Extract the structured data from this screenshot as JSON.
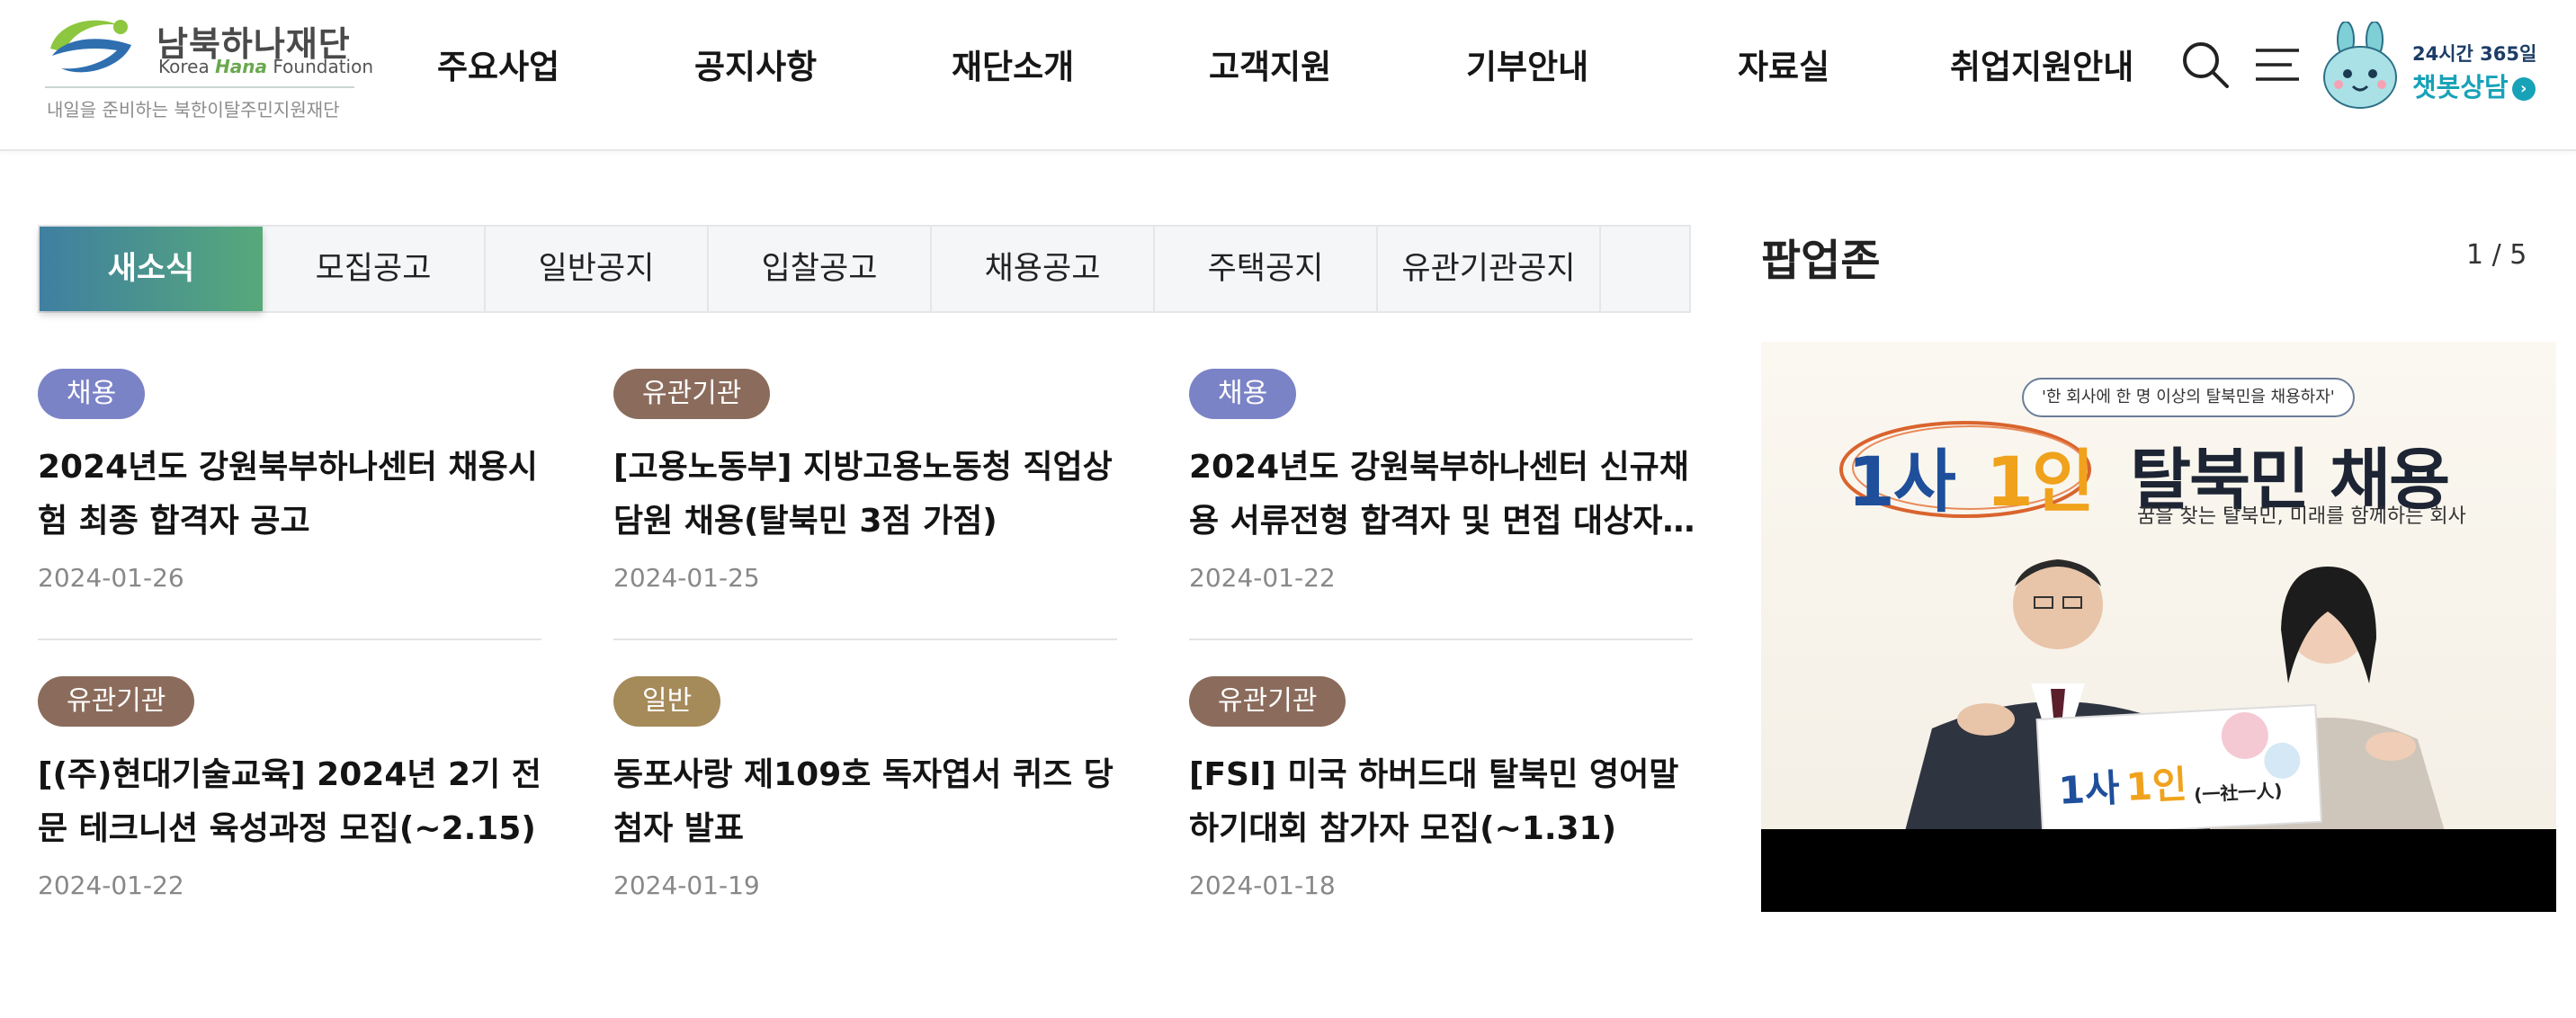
{
  "logo": {
    "korean": "남북하나재단",
    "english_pre": "Korea ",
    "english_hana": "Hana",
    "english_post": " Foundation",
    "tagline": "내일을 준비하는 북한이탈주민지원재단"
  },
  "nav": {
    "items": [
      "주요사업",
      "공지사항",
      "재단소개",
      "고객지원",
      "기부안내",
      "자료실",
      "취업지원안내"
    ]
  },
  "chatbot": {
    "top": "24시간 365일",
    "bottom": "챗봇상담",
    "arrow": "›"
  },
  "tabs": {
    "items": [
      "새소식",
      "모집공고",
      "일반공지",
      "입찰공고",
      "채용공고",
      "주택공지",
      "유관기관공지"
    ],
    "active": "새소식"
  },
  "news": {
    "items": [
      {
        "category": "채용",
        "category_color": "#7b83c7",
        "title": "2024년도 강원북부하나센터 채용시험 최종 합격자 공고",
        "date": "2024-01-26"
      },
      {
        "category": "유관기관",
        "category_color": "#8b6c5c",
        "title": "[고용노동부] 지방고용노동청 직업상담원 채용(탈북민 3점 가점)",
        "date": "2024-01-25"
      },
      {
        "category": "채용",
        "category_color": "#7b83c7",
        "title": "2024년도 강원북부하나센터 신규채용 서류전형 합격자 및 면접 대상자 공고",
        "date": "2024-01-22"
      },
      {
        "category": "유관기관",
        "category_color": "#8b6c5c",
        "title": "[(주)현대기술교육] 2024년 2기 전문 테크니션 육성과정 모집(~2.15)",
        "date": "2024-01-22"
      },
      {
        "category": "일반",
        "category_color": "#a58a5a",
        "title": "동포사랑 제109호 독자엽서 퀴즈 당첨자 발표",
        "date": "2024-01-19"
      },
      {
        "category": "유관기관",
        "category_color": "#8b6c5c",
        "title": "[FSI] 미국 하버드대 탈북민 영어말하기대회 참가자 모집(~1.31)",
        "date": "2024-01-18"
      }
    ]
  },
  "popup": {
    "title": "팝업존",
    "counter": "1 / 5",
    "banner": {
      "quote": "'한 회사에 한 명 이상의 탈북민을 채용하자'",
      "part1": "1사",
      "part2": "1인",
      "main": "탈북민 채용",
      "sub": "꿈을 찾는 탈북민, 미래를 함께하는 회사",
      "board1": "1사",
      "board2": "1인",
      "board_hanja": "(一社一人)"
    }
  },
  "colors": {
    "tab_gradient_start": "#3f7fa1",
    "tab_gradient_end": "#57a97a",
    "chatbot_accent": "#17a2b8"
  }
}
